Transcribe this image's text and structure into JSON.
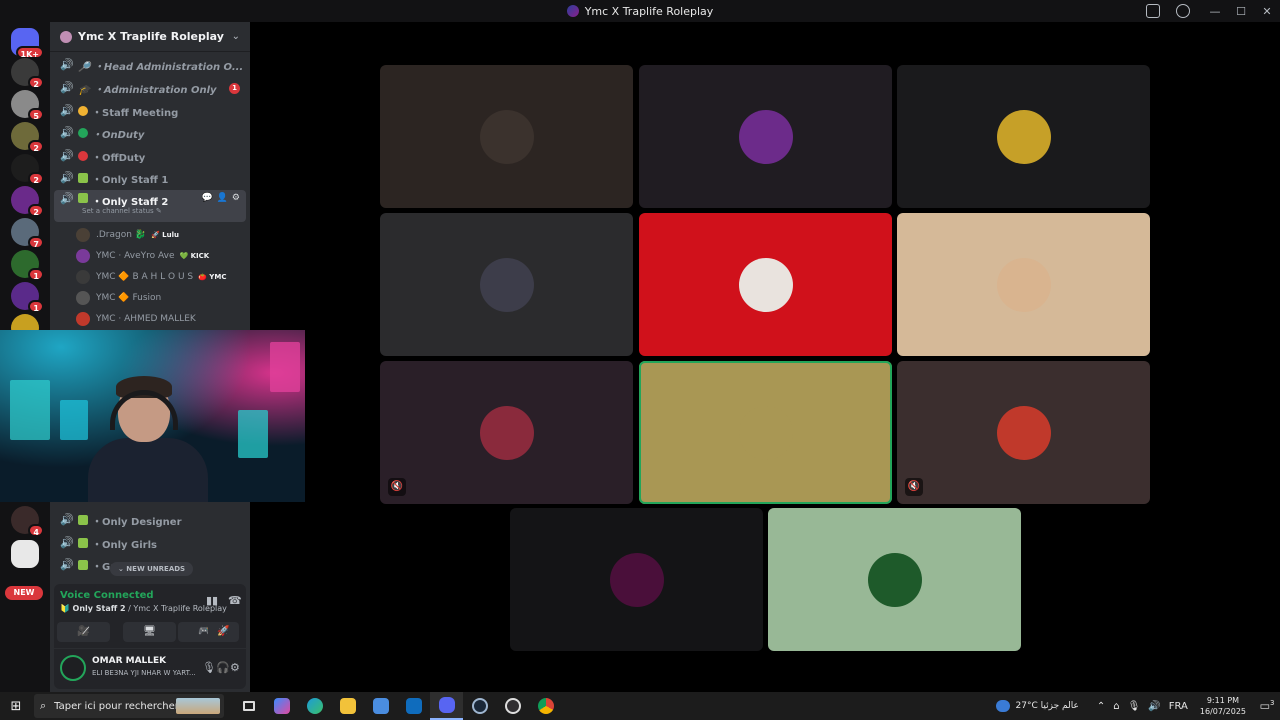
{
  "window": {
    "title": "Ymc X Traplife Roleplay",
    "controls": [
      "—",
      "☐",
      "✕"
    ]
  },
  "guild_rail": {
    "home_badge": "1K+",
    "badges": [
      "2",
      "5",
      "2",
      "2",
      "2",
      "7",
      "1",
      "1",
      "4"
    ],
    "new_label": "NEW"
  },
  "server": {
    "name": "Ymc X Traplife Roleplay"
  },
  "channels": [
    {
      "name": "🔎 ・Head Administration O...",
      "emoji_color": "#9aa3ff",
      "italic": true
    },
    {
      "name": "🎓 ・Administration Only",
      "emoji_color": "#c9c9c9",
      "italic": true,
      "badge": "1"
    },
    {
      "name": "・Staff Meeting",
      "emoji_color": "#f0b232",
      "italic": false
    },
    {
      "name": "・OnDuty",
      "emoji_color": "#23a55a",
      "italic": true
    },
    {
      "name": "・OffDuty",
      "emoji_color": "#da373c",
      "italic": false
    },
    {
      "name": "・Only Staff 1",
      "emoji_color": "#8bc34a",
      "italic": false
    },
    {
      "name": "・Only Staff 2",
      "emoji_color": "#8bc34a",
      "italic": false,
      "active": true,
      "status": "Set a channel status ✎"
    },
    {
      "name": "・Only Designer",
      "emoji_color": "#8bc34a",
      "italic": false
    },
    {
      "name": "・Only Girls",
      "emoji_color": "#8bc34a",
      "italic": false
    },
    {
      "name": "・Ga...",
      "emoji_color": "#8bc34a",
      "italic": false
    }
  ],
  "members": [
    {
      "name": ".Dragon 🐉",
      "tag": "🚀 Lulu",
      "color": "#4a4036"
    },
    {
      "name": "YMC · AveYro Ave",
      "tag": "💚 KICK",
      "color": "#7a3a9a"
    },
    {
      "name": "YMC 🔶 B A H L O U S",
      "tag": "🍅 YMC",
      "color": "#3a3a3a"
    },
    {
      "name": "YMC 🔶 Fusion",
      "tag": "",
      "color": "#555"
    },
    {
      "name": "YMC · AHMED MALLEK",
      "tag": "",
      "color": "#c0392b"
    }
  ],
  "new_unreads": "⌄ NEW UNREADS",
  "voice": {
    "status": "Voice Connected",
    "channel": "Only Staff 2",
    "server": "Ymc X Traplife Roleplay",
    "buttons": [
      "🎥̸",
      "🖥",
      "🎮",
      "🚀"
    ]
  },
  "user": {
    "name": "OMAR MALLEK",
    "status": "ELI BE3NA YJI NHAR W YART..."
  },
  "tiles": [
    {
      "bg": "#2c2522",
      "avatar": "#3b322d",
      "speaking": false,
      "muted": false
    },
    {
      "bg": "#201c22",
      "avatar": "#6c2b8a",
      "speaking": false,
      "muted": false
    },
    {
      "bg": "#1a1a1c",
      "avatar": "#c6a028",
      "speaking": false,
      "muted": false
    },
    {
      "bg": "#2b2b2d",
      "avatar": "#3d3d4a",
      "speaking": false,
      "muted": false
    },
    {
      "bg": "#d0111b",
      "avatar": "#e9e3de",
      "speaking": false,
      "muted": false
    },
    {
      "bg": "#d5b998",
      "avatar": "#d9b48f",
      "speaking": false,
      "muted": false
    },
    {
      "bg": "#2a1f28",
      "avatar": "#8a2a3c",
      "speaking": false,
      "muted": true
    },
    {
      "bg": "#a99754",
      "avatar": "#a99754",
      "speaking": true,
      "muted": false,
      "more": true
    },
    {
      "bg": "#3b2e2e",
      "avatar": "#c0392b",
      "speaking": false,
      "muted": true
    },
    {
      "bg": "#141416",
      "avatar": "#4a0f3a",
      "speaking": false,
      "muted": false
    },
    {
      "bg": "#98b896",
      "avatar": "#1e5a2a",
      "speaking": false,
      "muted": false
    }
  ],
  "taskbar": {
    "search_placeholder": "Taper ici pour rechercher",
    "weather": "27°C عالم جزئيا",
    "lang": "FRA",
    "time": "9:11 PM",
    "date": "16/07/2025",
    "notif_count": "3"
  }
}
